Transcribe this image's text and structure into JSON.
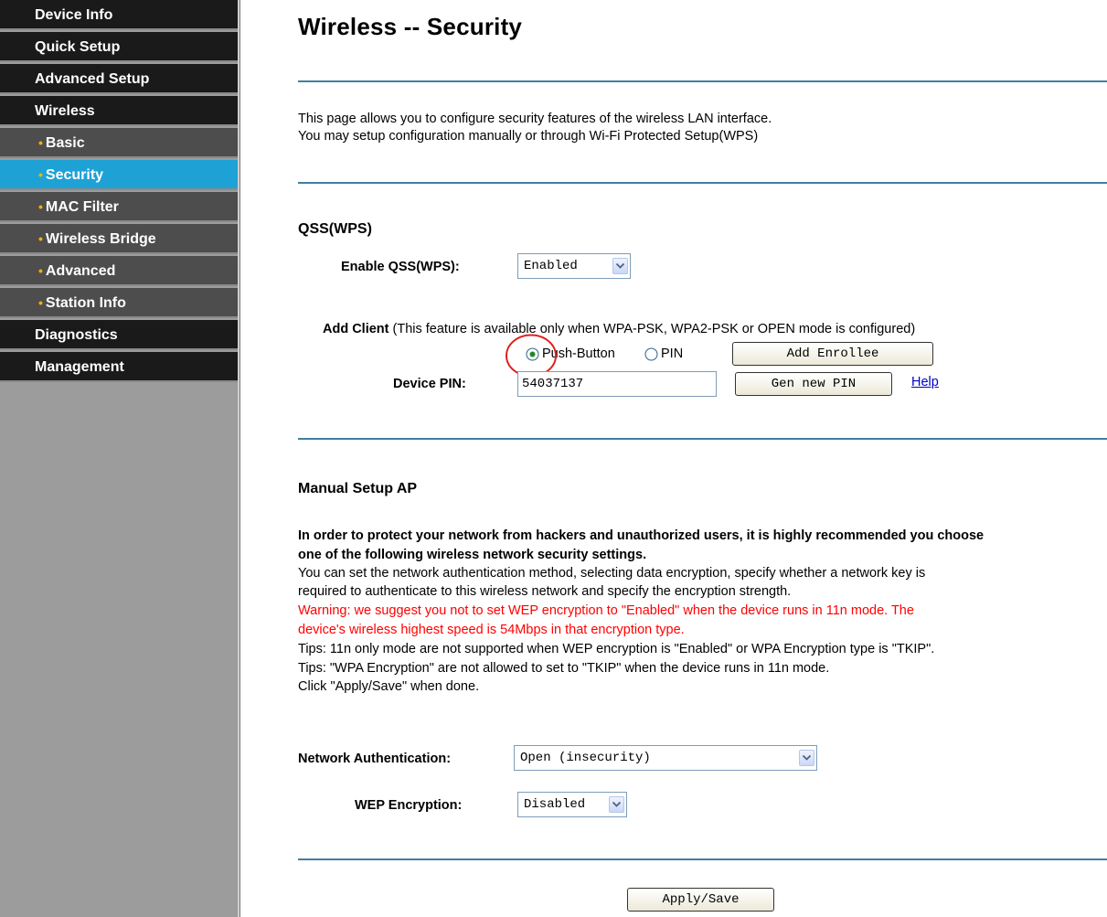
{
  "sidebar": {
    "items": [
      {
        "label": "Device Info"
      },
      {
        "label": "Quick Setup"
      },
      {
        "label": "Advanced Setup"
      },
      {
        "label": "Wireless"
      },
      {
        "label": "Basic"
      },
      {
        "label": "Security"
      },
      {
        "label": "MAC Filter"
      },
      {
        "label": "Wireless Bridge"
      },
      {
        "label": "Advanced"
      },
      {
        "label": "Station Info"
      },
      {
        "label": "Diagnostics"
      },
      {
        "label": "Management"
      }
    ],
    "active": "Security"
  },
  "page": {
    "title": "Wireless -- Security",
    "intro_line1": "This page allows you to configure security features of the wireless LAN interface.",
    "intro_line2": "You may setup configuration manually or through Wi-Fi Protected Setup(WPS)"
  },
  "qss": {
    "heading": "QSS(WPS)",
    "enable_label": "Enable QSS(WPS):",
    "enable_value": "Enabled",
    "add_client_bold": "Add Client",
    "add_client_note": " (This feature is available only when WPA-PSK, WPA2-PSK or OPEN mode is configured)",
    "push_button_label": "Push-Button",
    "pin_label": "PIN",
    "selected_mode": "Push-Button",
    "add_enrollee_label": "Add Enrollee",
    "device_pin_label": "Device PIN:",
    "device_pin_value": "54037137",
    "gen_pin_label": "Gen new PIN",
    "help_label": "Help"
  },
  "manual": {
    "heading": "Manual Setup AP",
    "bold_line1": "In order to protect your network from hackers and unauthorized users, it is highly recommended you choose",
    "bold_line2": "one of the following wireless network security settings.",
    "line3": "You can set the network authentication method, selecting data encryption, specify whether a network key is",
    "line4": "required to authenticate to this wireless network and specify the encryption strength.",
    "warning1": "Warning: we suggest you not to set WEP encryption to \"Enabled\" when the device runs in 11n mode. The",
    "warning2": "device's wireless highest speed is 54Mbps in that encryption type.",
    "tip1": "Tips: 11n only mode are not supported when WEP encryption is \"Enabled\" or WPA Encryption type is \"TKIP\".",
    "tip2": "Tips: \"WPA Encryption\" are not allowed to set to \"TKIP\" when the device runs in 11n mode.",
    "click_note": "Click \"Apply/Save\" when done.",
    "auth_label": "Network Authentication:",
    "auth_value": "Open (insecurity)",
    "wep_label": "WEP Encryption:",
    "wep_value": "Disabled",
    "apply_label": "Apply/Save"
  },
  "colors": {
    "sidebar_item": "#1a1a1a",
    "sidebar_sub": "#4d4d4d",
    "sidebar_active": "#1ea2d6",
    "bullet": "#f2b100",
    "rule": "#3f7fa0",
    "warning": "#ff0000",
    "annotation_circle": "#e0201c"
  }
}
